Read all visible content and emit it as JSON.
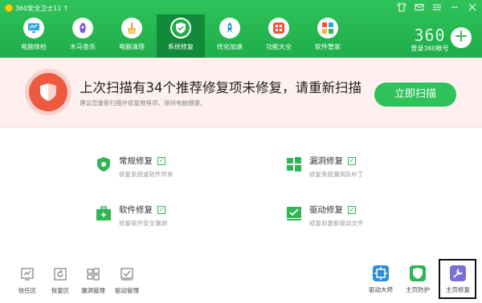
{
  "app": {
    "title": "360安全卫士11",
    "update_arrow": "↑"
  },
  "window_controls": [
    "shirt-icon",
    "mail-icon",
    "menu-icon",
    "minimize-icon",
    "close-icon"
  ],
  "nav": [
    {
      "label": "电脑体检",
      "icon": "monitor-icon"
    },
    {
      "label": "木马查杀",
      "icon": "trojan-icon"
    },
    {
      "label": "电脑清理",
      "icon": "broom-icon"
    },
    {
      "label": "系统修复",
      "icon": "shield-icon",
      "active": true
    },
    {
      "label": "优化加速",
      "icon": "rocket-icon"
    },
    {
      "label": "功能大全",
      "icon": "grid-icon"
    },
    {
      "label": "软件管家",
      "icon": "software-icon"
    }
  ],
  "brand": {
    "logo": "360",
    "account": "登录360帐号"
  },
  "banner": {
    "title": "上次扫描有34个推荐修复项未修复，请重新扫描",
    "subtitle": "建议您重新扫描并修复推荐项，保持电脑健康。",
    "scan_button": "立即扫描"
  },
  "cards": [
    {
      "title": "常规修复",
      "desc": "修复系统或软件异常"
    },
    {
      "title": "漏洞修复",
      "desc": "修复系统漏洞及补丁"
    },
    {
      "title": "软件修复",
      "desc": "修复软件安全漏洞"
    },
    {
      "title": "驱动修复",
      "desc": "修复和更新驱动文件"
    }
  ],
  "tools_left": [
    "信任区",
    "恢复区",
    "漏洞管理",
    "驱动管理"
  ],
  "tools_right": [
    "驱动大师",
    "主页防护",
    "主页修复"
  ],
  "colors": {
    "brand_green": "#2fc25a",
    "active_nav": "#138a3a",
    "banner_bg": "#fdf0ee",
    "alert": "#ee5a3f"
  }
}
